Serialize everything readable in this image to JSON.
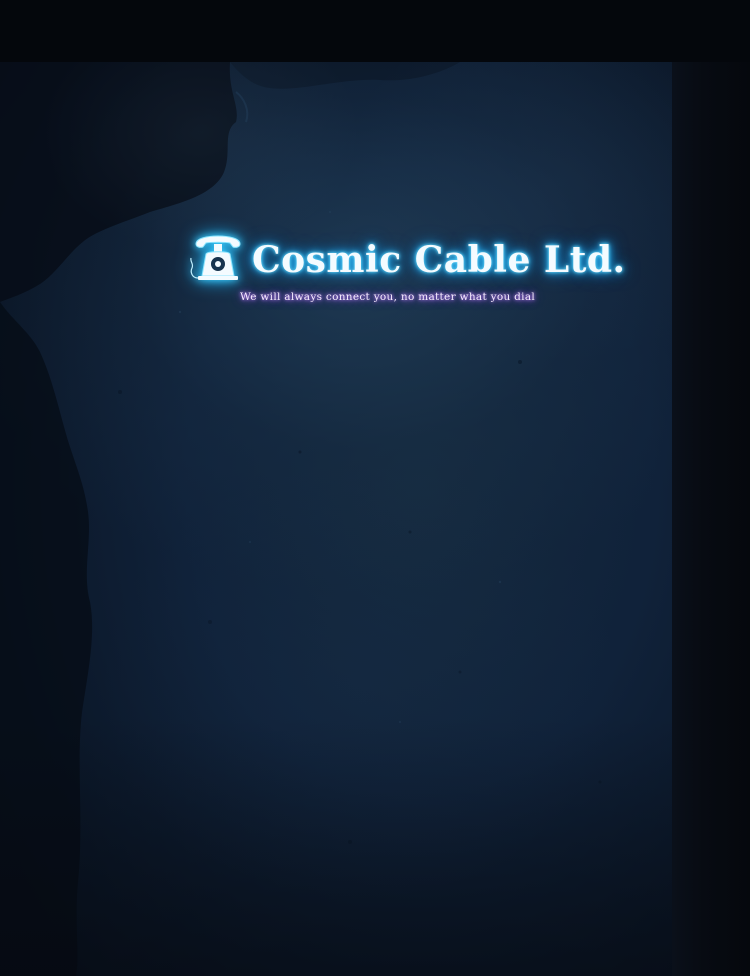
{
  "brand": {
    "name": "Cosmic Cable Ltd.",
    "tagline": "We will always connect you, no matter what you dial",
    "icon": "rotary-telephone-icon"
  },
  "colors": {
    "background": "#05080e",
    "panel": "#10223a",
    "glow_cyan": "#2ec0ff",
    "glow_violet": "#9a5ce8"
  }
}
